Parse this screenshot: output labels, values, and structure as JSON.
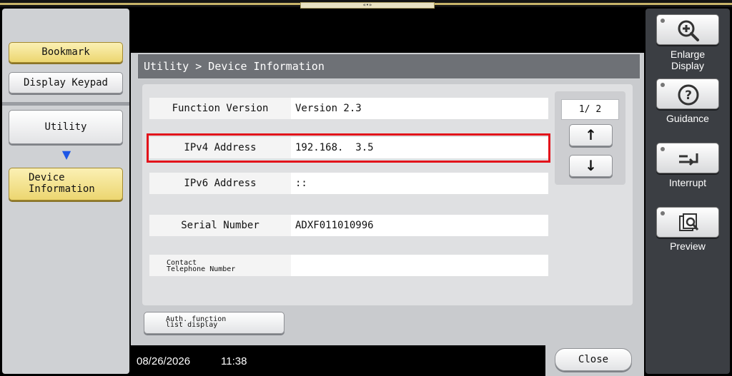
{
  "top_tab": {
    "label": "«•»"
  },
  "left_panel": {
    "bookmark": "Bookmark",
    "display_keypad": "Display Keypad",
    "utility": "Utility",
    "device_information_line1": "Device",
    "device_information_line2": "Information",
    "arrow_icon": "arrow-down"
  },
  "dialog": {
    "title": "Utility > Device Information",
    "rows": [
      {
        "label": "Function Version",
        "value": "Version 2.3"
      },
      {
        "label": "IPv4 Address",
        "value": "192.168.  3.5"
      },
      {
        "label": "IPv6 Address",
        "value": "::"
      },
      {
        "label": "Serial Number",
        "value": "ADXF011010996"
      },
      {
        "label_line1": "Contact",
        "label_line2": "Telephone Number",
        "value": ""
      }
    ],
    "page_indicator": "1/ 2",
    "up_icon": "arrow-up",
    "down_icon": "arrow-down",
    "auth_line1": "Auth. function",
    "auth_line2": "list display",
    "close": "Close",
    "highlight_color": "#e3131b"
  },
  "status": {
    "date": "08/26/2026",
    "time": "11:38"
  },
  "right_panel": {
    "enlarge_line1": "Enlarge",
    "enlarge_line2": "Display",
    "guidance": "Guidance",
    "interrupt": "Interrupt",
    "preview": "Preview"
  }
}
